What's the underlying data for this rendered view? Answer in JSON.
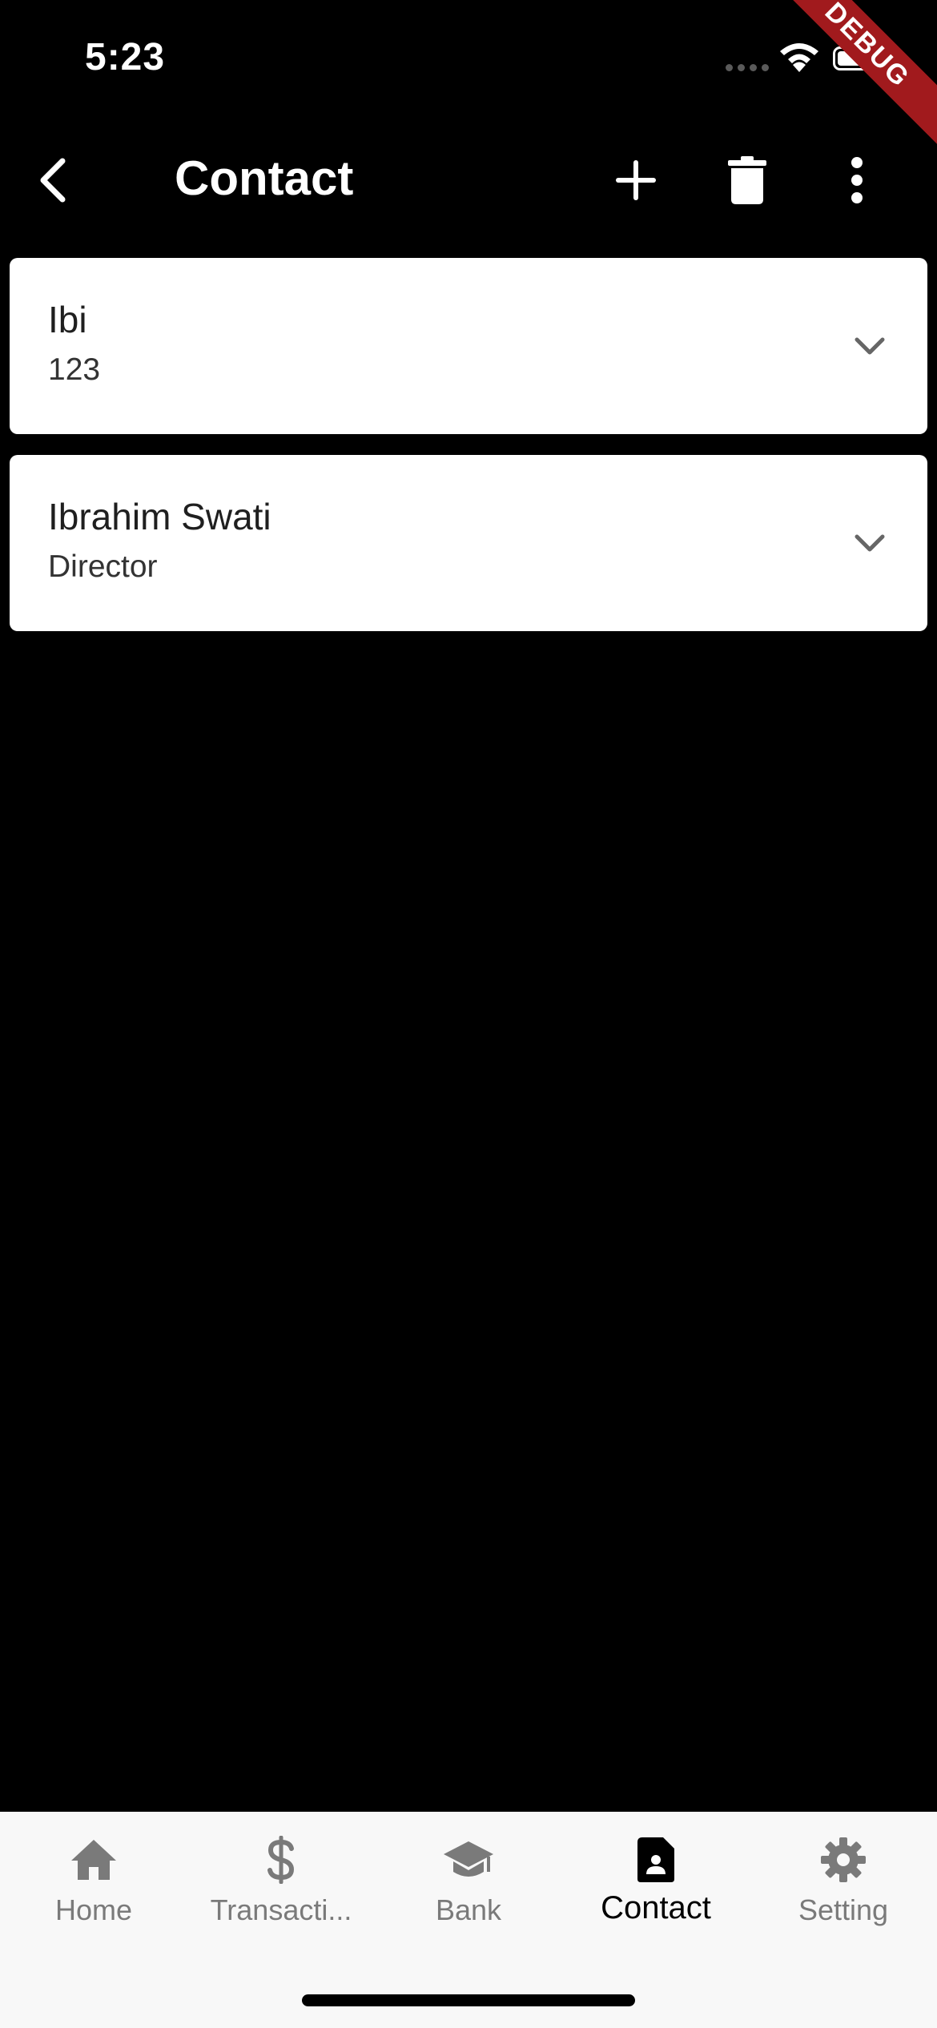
{
  "status_bar": {
    "time": "5:23",
    "debug_label": "DEBUG"
  },
  "app_bar": {
    "title": "Contact",
    "back_icon": "chevron-left-icon",
    "actions": [
      "plus-icon",
      "trash-icon",
      "more-vertical-icon"
    ]
  },
  "contacts": [
    {
      "name": "Ibi",
      "subtitle": "123"
    },
    {
      "name": "Ibrahim Swati",
      "subtitle": "Director"
    }
  ],
  "bottom_nav": {
    "active_index": 3,
    "items": [
      {
        "label": "Home",
        "icon": "home-icon"
      },
      {
        "label": "Transacti...",
        "icon": "dollar-icon"
      },
      {
        "label": "Bank",
        "icon": "graduation-cap-icon"
      },
      {
        "label": "Contact",
        "icon": "contact-card-icon"
      },
      {
        "label": "Setting",
        "icon": "gear-icon"
      }
    ]
  },
  "colors": {
    "background": "#000000",
    "card": "#ffffff",
    "nav_background": "#f8f8f8",
    "nav_inactive": "#7a7a7a",
    "nav_active": "#000000",
    "debug_banner": "#a11a1d"
  }
}
